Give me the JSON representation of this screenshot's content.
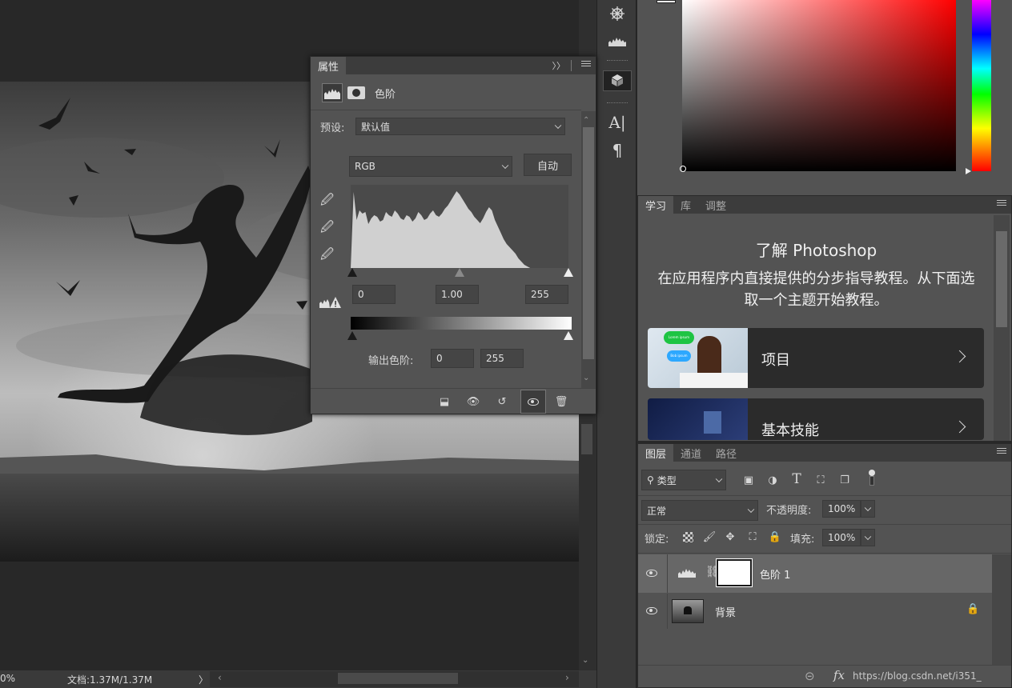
{
  "canvas": {
    "image_alt": "黑白照片：舞者在海面上空跳跃"
  },
  "status": {
    "zoom": "0%",
    "doc": "文档:1.37M/1.37M",
    "arrow_right": "〉",
    "scroll_left": "‹",
    "scroll_right": "›"
  },
  "properties": {
    "tab": "属性",
    "collapse": "〉〉",
    "type_label": "色阶",
    "preset_label": "预设:",
    "preset_value": "默认值",
    "channel": "RGB",
    "auto_button": "自动",
    "input_black": "0",
    "input_gamma": "1.00",
    "input_white": "255",
    "output_label": "输出色阶:",
    "output_black": "0",
    "output_white": "255",
    "histogram_levels": [
      0,
      95,
      60,
      72,
      68,
      70,
      55,
      62,
      66,
      64,
      58,
      60,
      70,
      66,
      64,
      72,
      68,
      62,
      60,
      66,
      64,
      58,
      62,
      70,
      66,
      60,
      62,
      68,
      72,
      66,
      64,
      68,
      74,
      78,
      84,
      90,
      96,
      92,
      86,
      80,
      74,
      70,
      64,
      60,
      56,
      62,
      70,
      76,
      72,
      60,
      52,
      44,
      36,
      30,
      26,
      22,
      18,
      12,
      8,
      4,
      2,
      0,
      0,
      0,
      0,
      0,
      0,
      0,
      0,
      0,
      0,
      0,
      0,
      0,
      0
    ]
  },
  "learn": {
    "tabs": [
      "学习",
      "库",
      "调整"
    ],
    "title": "了解 Photoshop",
    "desc": "在应用程序内直接提供的分步指导教程。从下面选取一个主题开始教程。",
    "cards": [
      {
        "label": "项目",
        "bubble1": "Lorem ipsum",
        "bubble2": "Bob ipsum"
      },
      {
        "label": "基本技能"
      }
    ]
  },
  "layers": {
    "tabs": [
      "图层",
      "通道",
      "路径"
    ],
    "filter_label": "类型",
    "blend_mode": "正常",
    "opacity_label": "不透明度:",
    "opacity_value": "100%",
    "lock_label": "锁定:",
    "fill_label": "填充:",
    "fill_value": "100%",
    "items": [
      {
        "name": "色阶 1"
      },
      {
        "name": "背景"
      }
    ],
    "footer_fx": "fx",
    "watermark": "https://blog.csdn.net/i351_"
  },
  "colors": {
    "accent": "#535353",
    "dark": "#282828",
    "hue_top": "#ff0000"
  }
}
